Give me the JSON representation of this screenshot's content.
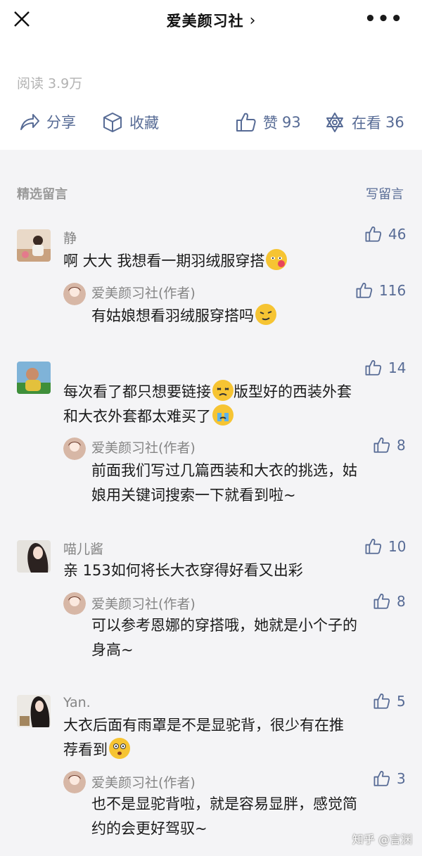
{
  "header": {
    "title": "爱美颜习社",
    "chevron": "›"
  },
  "article": {
    "reads": "阅读 3.9万",
    "share_label": "分享",
    "favorite_label": "收藏",
    "like_label": "赞",
    "like_count": "93",
    "watching_label": "在看",
    "watching_count": "36"
  },
  "comments_section": {
    "heading": "精选留言",
    "write_label": "写留言"
  },
  "comments": [
    {
      "name": "静",
      "likes": "46",
      "text": "啊 大大 我想看一期羽绒服穿搭",
      "reply": {
        "name": "爱美颜习社(作者)",
        "likes": "116",
        "text": "有姑娘想看羽绒服穿搭吗"
      }
    },
    {
      "name": "",
      "likes": "14",
      "text_line1": "每次看了都只想要链接",
      "text_line1b": "版型好的西装外套",
      "text_line2": "和大衣外套都太难买了",
      "reply": {
        "name": "爱美颜习社(作者)",
        "likes": "8",
        "line1": "前面我们写过几篇西装和大衣的挑选，姑",
        "line2": "娘用关键词搜索一下就看到啦~"
      }
    },
    {
      "name": "喵儿酱",
      "likes": "10",
      "text": "亲 153如何将长大衣穿得好看又出彩",
      "reply": {
        "name": "爱美颜习社(作者)",
        "likes": "8",
        "line1": "可以参考恩娜的穿搭哦，她就是小个子的",
        "line2": "身高~"
      }
    },
    {
      "name": "Yan.",
      "likes": "5",
      "line1": "大衣后面有雨罩是不是显驼背，很少有在推",
      "line2": "荐看到",
      "reply": {
        "name": "爱美颜习社(作者)",
        "likes": "3",
        "line1": "也不是显驼背啦，就是容易显胖，感觉简",
        "line2": "约的会更好驾驭~"
      }
    }
  ],
  "watermark": "知乎 @言渊",
  "colors": {
    "link": "#576b95",
    "muted": "#858585",
    "background": "#f4f4f6"
  }
}
